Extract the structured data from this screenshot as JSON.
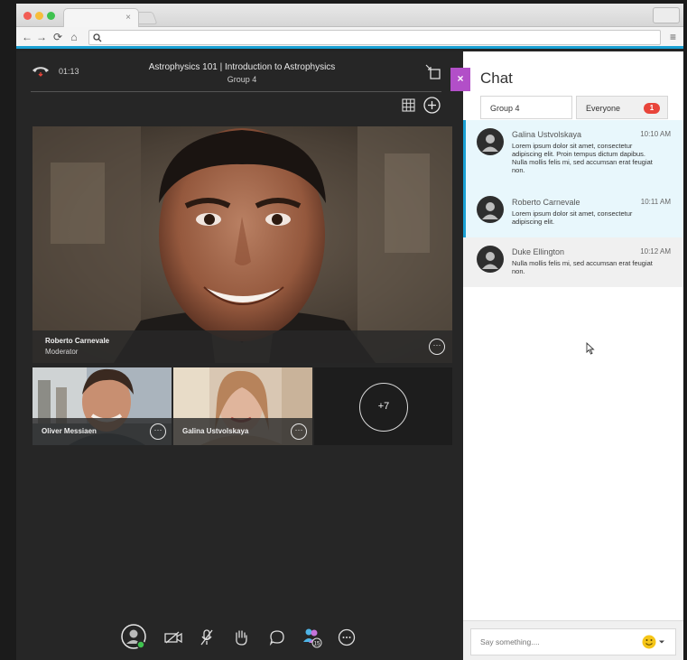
{
  "browser": {
    "tab_close": "×",
    "url": ""
  },
  "session": {
    "timer": "01:13",
    "title": "Astrophysics 101  |  Introduction to Astrophysics",
    "group": "Group 4"
  },
  "main_video": {
    "name": "Roberto Carnevale",
    "role": "Moderator",
    "more": "···"
  },
  "thumbnails": [
    {
      "name": "Oliver Messiaen",
      "more": "···"
    },
    {
      "name": "Galina Ustvolskaya",
      "more": "···"
    }
  ],
  "overflow": {
    "label": "+7"
  },
  "controls": {
    "participants_badge": "15"
  },
  "chat": {
    "title": "Chat",
    "close": "×",
    "tabs": [
      {
        "label": "Group 4"
      },
      {
        "label": "Everyone",
        "badge": "1"
      }
    ],
    "messages": [
      {
        "name": "Galina Ustvolskaya",
        "time": "10:10 AM",
        "text": "Lorem ipsum dolor sit amet, consectetur adipiscing elit. Proin tempus dictum dapibus. Nulla mollis felis mi, sed accumsan erat feugiat non."
      },
      {
        "name": "Roberto Carnevale",
        "time": "10:11 AM",
        "text": "Lorem ipsum dolor sit amet, consectetur adipiscing elit."
      },
      {
        "name": "Duke Ellington",
        "time": "10:12 AM",
        "text": "Nulla mollis felis mi, sed accumsan erat feugiat non."
      }
    ],
    "input_placeholder": "Say something...."
  },
  "colors": {
    "accent": "#1aa0d3",
    "close_purple": "#b24fc8",
    "highlight_bg": "#e8f7fc",
    "badge_red": "#e8443a"
  }
}
